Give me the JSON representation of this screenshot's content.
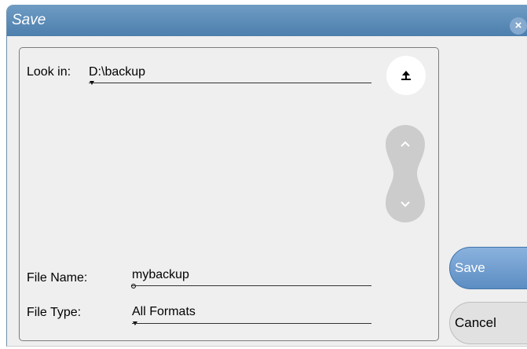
{
  "dialog": {
    "title": "Save",
    "close_glyph": "×"
  },
  "look_in": {
    "label": "Look in:",
    "value": "D:\\backup"
  },
  "file_name": {
    "label": "File Name:",
    "value": "mybackup"
  },
  "file_type": {
    "label": "File Type:",
    "value": "All Formats"
  },
  "buttons": {
    "save": "Save",
    "cancel": "Cancel"
  },
  "icons": {
    "up_folder": "up-folder-arrow-icon",
    "scroll_up": "chevron-up-icon",
    "scroll_down": "chevron-down-icon",
    "close": "close-icon"
  },
  "colors": {
    "titlebar": "#5a89b6",
    "save_button": "#6f9fd1",
    "cancel_button": "#e1e1e1"
  }
}
